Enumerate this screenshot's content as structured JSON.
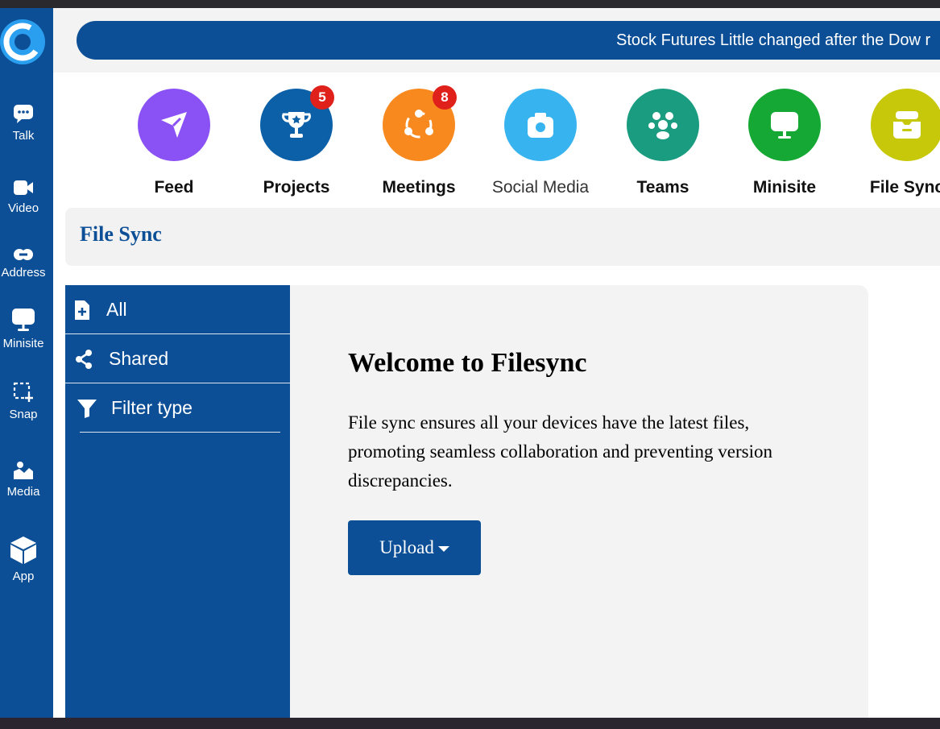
{
  "ticker": {
    "text": "Stock Futures Little changed after the Dow r"
  },
  "rail": {
    "items": [
      {
        "label": "Talk",
        "icon": "chat-icon"
      },
      {
        "label": "Video",
        "icon": "video-camera-icon"
      },
      {
        "label": "Address",
        "icon": "link-icon"
      },
      {
        "label": "Minisite",
        "icon": "monitor-icon"
      },
      {
        "label": "Snap",
        "icon": "screenshot-select-icon"
      },
      {
        "label": "Media",
        "icon": "image-icon"
      },
      {
        "label": "App",
        "icon": "cube-icon"
      }
    ]
  },
  "apps": [
    {
      "label": "Feed",
      "icon": "paper-plane-icon",
      "color": "#8a52f5"
    },
    {
      "label": "Projects",
      "icon": "trophy-icon",
      "color": "#0c60a8",
      "badge": "5"
    },
    {
      "label": "Meetings",
      "icon": "share-nodes-icon",
      "color": "#f7891f",
      "badge": "8"
    },
    {
      "label": "Social Media",
      "icon": "camera-icon",
      "color": "#37b3ef"
    },
    {
      "label": "Teams",
      "icon": "users-icon",
      "color": "#1a9c80"
    },
    {
      "label": "Minisite",
      "icon": "monitor-icon",
      "color": "#16a834"
    },
    {
      "label": "File Sync",
      "icon": "folder-sync-icon",
      "color": "#c7c80a"
    }
  ],
  "section": {
    "title": "File Sync"
  },
  "menu": {
    "all": "All",
    "shared": "Shared",
    "filter": "Filter type"
  },
  "welcome": {
    "title": "Welcome to Filesync",
    "body": "File sync ensures all your devices have the latest files, promoting seamless collaboration and preventing version discrepancies.",
    "upload_label": "Upload"
  },
  "colors": {
    "brand": "#0c4f96",
    "badge": "#e0211b"
  }
}
